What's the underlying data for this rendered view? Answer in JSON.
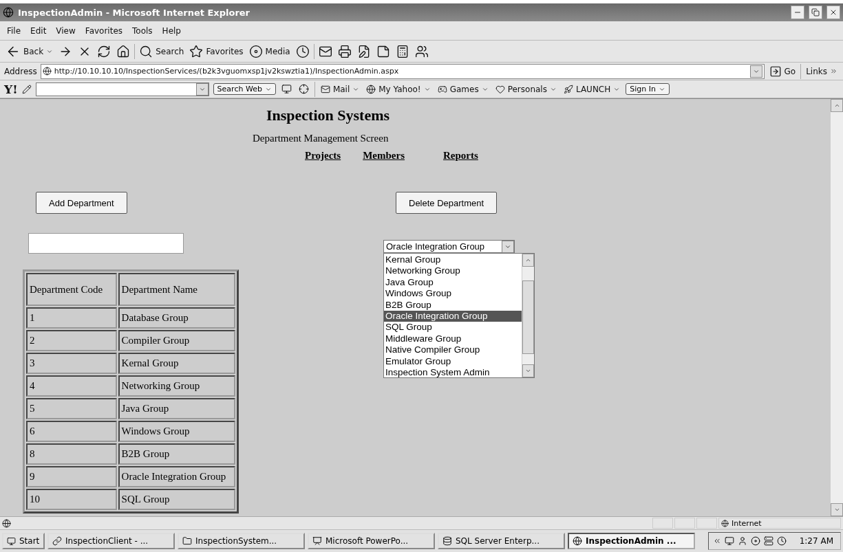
{
  "window": {
    "title": "InspectionAdmin - Microsoft Internet Explorer"
  },
  "menu": [
    "File",
    "Edit",
    "View",
    "Favorites",
    "Tools",
    "Help"
  ],
  "toolbar": [
    {
      "label": "Back"
    },
    {
      "label": "Search"
    },
    {
      "label": "Favorites"
    },
    {
      "label": "Media"
    }
  ],
  "address_bar": {
    "label": "Address",
    "url": "http://10.10.10.10/InspectionServices/(b2k3vguomxsp1jv2kswztia1)/InspectionAdmin.aspx",
    "go": "Go",
    "links": "Links"
  },
  "yahoo_toolbar": {
    "logo": "Y!",
    "search_button": "Search Web",
    "links": [
      "Mail",
      "My Yahoo!",
      "Games",
      "Personals",
      "LAUNCH"
    ],
    "sign_in": "Sign In"
  },
  "page": {
    "title": "Inspection Systems",
    "subtitle": "Department Management Screen",
    "nav": [
      "Projects",
      "Members",
      "Reports"
    ],
    "add_button": "Add Department",
    "delete_button": "Delete Department",
    "department_select": "Oracle Integration Group",
    "department_list": [
      {
        "label": "Kernal Group",
        "selected": false
      },
      {
        "label": "Networking Group",
        "selected": false
      },
      {
        "label": "Java Group",
        "selected": false
      },
      {
        "label": "Windows Group",
        "selected": false
      },
      {
        "label": "B2B Group",
        "selected": false
      },
      {
        "label": "Oracle Integration Group",
        "selected": true
      },
      {
        "label": "SQL Group",
        "selected": false
      },
      {
        "label": "Middleware Group",
        "selected": false
      },
      {
        "label": "Native Compiler Group",
        "selected": false
      },
      {
        "label": "Emulator Group",
        "selected": false
      },
      {
        "label": "Inspection System Admin",
        "selected": false
      }
    ],
    "table": {
      "columns": [
        "Department Code",
        "Department Name"
      ],
      "rows": [
        [
          "1",
          "Database Group"
        ],
        [
          "2",
          "Compiler Group"
        ],
        [
          "3",
          "Kernal Group"
        ],
        [
          "4",
          "Networking Group"
        ],
        [
          "5",
          "Java Group"
        ],
        [
          "6",
          "Windows Group"
        ],
        [
          "8",
          "B2B Group"
        ],
        [
          "9",
          "Oracle Integration Group"
        ],
        [
          "10",
          "SQL Group"
        ]
      ]
    }
  },
  "status_bar": {
    "zone": "Internet"
  },
  "taskbar": {
    "start": "Start",
    "tasks": [
      {
        "label": "InspectionClient - ...",
        "selected": false
      },
      {
        "label": "InspectionSystem...",
        "selected": false
      },
      {
        "label": "Microsoft PowerPo...",
        "selected": false
      },
      {
        "label": "SQL Server Enterp...",
        "selected": false
      },
      {
        "label": "InspectionAdmin ...",
        "selected": true
      }
    ],
    "clock": "1:27 AM"
  }
}
